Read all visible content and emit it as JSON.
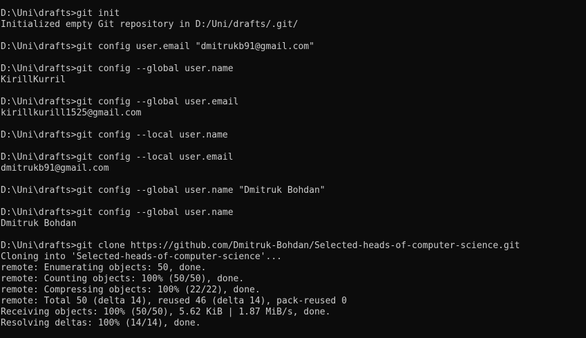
{
  "terminal": {
    "lines": [
      "D:\\Uni\\drafts>git init",
      "Initialized empty Git repository in D:/Uni/drafts/.git/",
      "",
      "D:\\Uni\\drafts>git config user.email \"dmitrukb91@gmail.com\"",
      "",
      "D:\\Uni\\drafts>git config --global user.name",
      "KirillKurril",
      "",
      "D:\\Uni\\drafts>git config --global user.email",
      "kirillkurill1525@gmail.com",
      "",
      "D:\\Uni\\drafts>git config --local user.name",
      "",
      "D:\\Uni\\drafts>git config --local user.email",
      "dmitrukb91@gmail.com",
      "",
      "D:\\Uni\\drafts>git config --global user.name \"Dmitruk Bohdan\"",
      "",
      "D:\\Uni\\drafts>git config --global user.name",
      "Dmitruk Bohdan",
      "",
      "D:\\Uni\\drafts>git clone https://github.com/Dmitruk-Bohdan/Selected-heads-of-computer-science.git",
      "Cloning into 'Selected-heads-of-computer-science'...",
      "remote: Enumerating objects: 50, done.",
      "remote: Counting objects: 100% (50/50), done.",
      "remote: Compressing objects: 100% (22/22), done.",
      "remote: Total 50 (delta 14), reused 46 (delta 14), pack-reused 0",
      "Receiving objects: 100% (50/50), 5.62 KiB | 1.87 MiB/s, done.",
      "Resolving deltas: 100% (14/14), done."
    ]
  }
}
